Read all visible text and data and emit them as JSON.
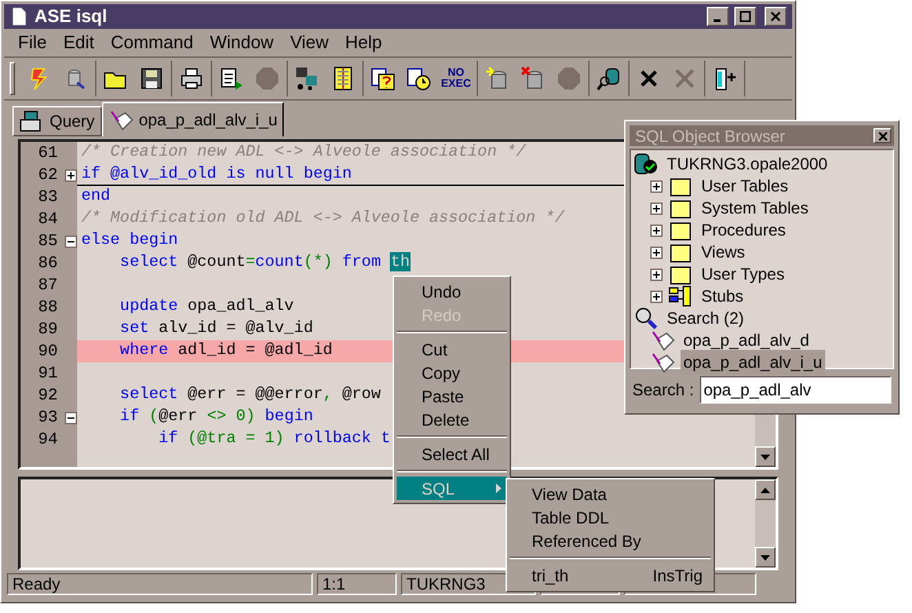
{
  "window": {
    "title": "ASE isql"
  },
  "menu": [
    "File",
    "Edit",
    "Command",
    "Window",
    "View",
    "Help"
  ],
  "toolbar": {
    "no_exec_label": "NO EXEC"
  },
  "tabs": [
    {
      "label": "Query",
      "selected": false
    },
    {
      "label": "opa_p_adl_alv_i_u",
      "selected": true
    }
  ],
  "editor": {
    "lines": [
      {
        "number": "61",
        "tokens": [
          {
            "kind": "comment",
            "text": "/* Creation new ADL <-> Alveole association */"
          }
        ]
      },
      {
        "number": "62",
        "collapsed": true,
        "tokens": [
          {
            "kind": "keyword",
            "text": "if @alv_id_old is null begin"
          }
        ]
      },
      {
        "number": "83",
        "tokens": [
          {
            "kind": "keyword",
            "text": "end"
          }
        ]
      },
      {
        "number": "84",
        "tokens": [
          {
            "kind": "comment",
            "text": "/* Modification old ADL <-> Alveole association */"
          }
        ]
      },
      {
        "number": "85",
        "collapsed": false,
        "tokens": [
          {
            "kind": "keyword",
            "text": "else begin"
          }
        ]
      },
      {
        "number": "86",
        "tokens": [
          {
            "kind": "keyword",
            "text": "    select"
          },
          {
            "kind": "plain",
            "text": " @count"
          },
          {
            "kind": "symbol",
            "text": "="
          },
          {
            "kind": "keyword",
            "text": "count"
          },
          {
            "kind": "symbol",
            "text": "(*)"
          },
          {
            "kind": "keyword",
            "text": " from "
          },
          {
            "kind": "selected",
            "text": "th"
          }
        ]
      },
      {
        "number": "87"
      },
      {
        "number": "88",
        "tokens": [
          {
            "kind": "keyword",
            "text": "    update"
          },
          {
            "kind": "plain",
            "text": " opa_adl_alv"
          }
        ]
      },
      {
        "number": "89",
        "tokens": [
          {
            "kind": "keyword",
            "text": "    set"
          },
          {
            "kind": "plain",
            "text": " alv_id = @alv_id"
          }
        ]
      },
      {
        "number": "90",
        "highlight": true,
        "tokens": [
          {
            "kind": "keyword",
            "text": "    where"
          },
          {
            "kind": "plain",
            "text": " adl_id = @adl_id"
          }
        ]
      },
      {
        "number": "91"
      },
      {
        "number": "92",
        "tokens": [
          {
            "kind": "keyword",
            "text": "    select"
          },
          {
            "kind": "plain",
            "text": " @err = @@error"
          },
          {
            "kind": "symbol",
            "text": ","
          },
          {
            "kind": "plain",
            "text": " @row"
          }
        ]
      },
      {
        "number": "93",
        "collapsed": false,
        "tokens": [
          {
            "kind": "keyword",
            "text": "    if"
          },
          {
            "kind": "symbol",
            "text": " ("
          },
          {
            "kind": "plain",
            "text": "@err "
          },
          {
            "kind": "symbol",
            "text": "<> 0)"
          },
          {
            "kind": "keyword",
            "text": " begin"
          }
        ]
      },
      {
        "number": "94",
        "tokens": [
          {
            "kind": "keyword",
            "text": "        if"
          },
          {
            "kind": "symbol",
            "text": " (@tra = 1)"
          },
          {
            "kind": "keyword",
            "text": " rollback t"
          }
        ]
      }
    ]
  },
  "context_menu": {
    "items": [
      {
        "kind": "item",
        "label": "Undo",
        "disabled": false,
        "selected": false
      },
      {
        "kind": "item",
        "label": "Redo",
        "disabled": true,
        "selected": false
      },
      {
        "kind": "separator"
      },
      {
        "kind": "item",
        "label": "Cut",
        "disabled": false,
        "selected": false
      },
      {
        "kind": "item",
        "label": "Copy",
        "disabled": false,
        "selected": false
      },
      {
        "kind": "item",
        "label": "Paste",
        "disabled": false,
        "selected": false
      },
      {
        "kind": "item",
        "label": "Delete",
        "disabled": false,
        "selected": false
      },
      {
        "kind": "separator"
      },
      {
        "kind": "item",
        "label": "Select All",
        "disabled": false,
        "selected": false
      },
      {
        "kind": "separator"
      },
      {
        "kind": "submenu",
        "label": "SQL",
        "disabled": false,
        "selected": true
      }
    ]
  },
  "submenu": {
    "items": [
      {
        "kind": "item",
        "label": "View Data"
      },
      {
        "kind": "item",
        "label": "Table DDL"
      },
      {
        "kind": "item",
        "label": "Referenced By"
      },
      {
        "kind": "separator"
      },
      {
        "kind": "pair",
        "label": "tri_th",
        "detail": "InsTrig"
      }
    ]
  },
  "object_browser": {
    "title": "SQL Object Browser",
    "tree": [
      {
        "label": "TUKRNG3.opale2000",
        "kind": "server",
        "selected": false,
        "children": [
          {
            "label": "User Tables",
            "kind": "folder",
            "expanded": false,
            "selected": false
          },
          {
            "label": "System Tables",
            "kind": "folder",
            "expanded": false,
            "selected": false
          },
          {
            "label": "Procedures",
            "kind": "folder",
            "expanded": false,
            "selected": false
          },
          {
            "label": "Views",
            "kind": "folder",
            "expanded": false,
            "selected": false
          },
          {
            "label": "User Types",
            "kind": "folder",
            "expanded": false,
            "selected": false
          },
          {
            "label": "Stubs",
            "kind": "stubs",
            "expanded": false,
            "selected": false
          }
        ]
      },
      {
        "label": "Search (2)",
        "kind": "search",
        "selected": false,
        "children": [
          {
            "label": "opa_p_adl_alv_d",
            "kind": "proc",
            "selected": false
          },
          {
            "label": "opa_p_adl_alv_i_u",
            "kind": "proc",
            "selected": true
          }
        ]
      }
    ],
    "search_label": "Search :",
    "search_value": "opa_p_adl_alv"
  },
  "status_bar": [
    "Ready",
    "1:1",
    "TUKRNG3"
  ]
}
